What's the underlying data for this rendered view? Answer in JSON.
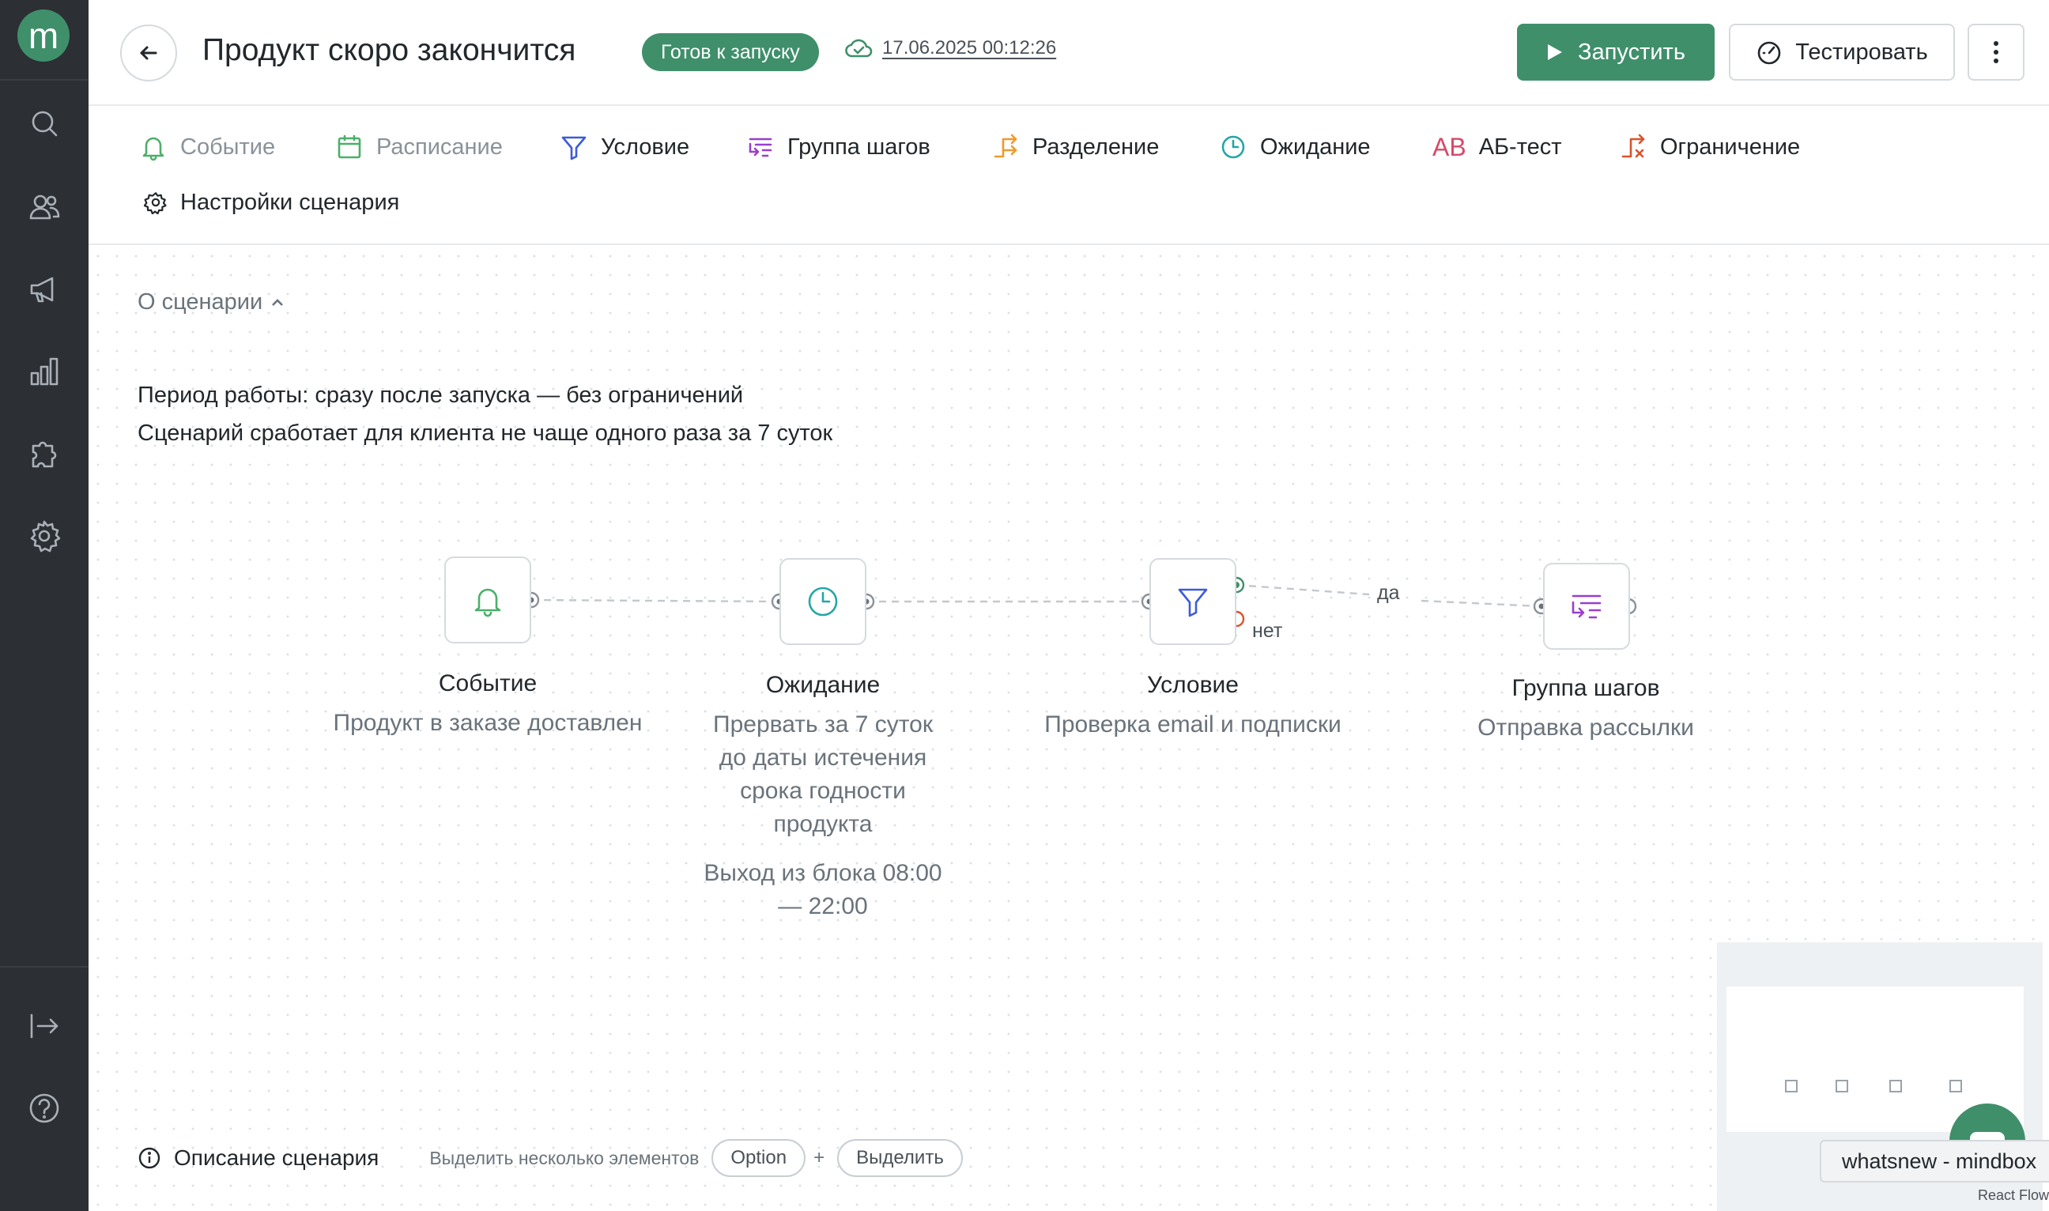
{
  "rail": {
    "logo": "m",
    "items": [
      {
        "icon": "search-icon"
      },
      {
        "icon": "users-icon"
      },
      {
        "icon": "megaphone-icon"
      },
      {
        "icon": "bar-chart-icon"
      },
      {
        "icon": "puzzle-icon"
      },
      {
        "icon": "gear-icon"
      },
      {
        "icon": "logout-icon"
      },
      {
        "icon": "help-icon"
      }
    ]
  },
  "header": {
    "title": "Продукт скоро закончится",
    "status": "Готов к запуску",
    "saved_at": "17.06.2025 00:12:26",
    "run_label": "Запустить",
    "test_label": "Тестировать"
  },
  "toolbar": {
    "items": [
      {
        "label": "Событие",
        "icon": "bell-icon",
        "color": "#4caf6a"
      },
      {
        "label": "Расписание",
        "icon": "calendar-icon",
        "color": "#4caf6a"
      },
      {
        "label": "Условие",
        "icon": "filter-icon",
        "color": "#3d5bd9"
      },
      {
        "label": "Группа шагов",
        "icon": "steps-group-icon",
        "color": "#9b3fc9"
      },
      {
        "label": "Разделение",
        "icon": "split-icon",
        "color": "#f09a2d"
      },
      {
        "label": "Ожидание",
        "icon": "clock-icon",
        "color": "#25a7a7"
      },
      {
        "label": "АБ-тест",
        "icon": "ab-icon",
        "color": "#d64a6a"
      },
      {
        "label": "Ограничение",
        "icon": "limit-icon",
        "color": "#d9532b"
      }
    ],
    "settings_label": "Настройки сценария"
  },
  "about": {
    "toggle_label": "О сценарии",
    "period": "Период работы: сразу после запуска — без ограничений",
    "frequency": "Сценарий сработает для клиента не чаще одного раза за 7 суток"
  },
  "flow": {
    "nodes": [
      {
        "title": "Событие",
        "subtitle": "Продукт в заказе доставлен",
        "icon": "bell-icon"
      },
      {
        "title": "Ожидание",
        "subtitle": "Прервать за 7 суток до даты истечения срока годности продукта",
        "extra": "Выход из блока 08:00 — 22:00",
        "icon": "clock-icon"
      },
      {
        "title": "Условие",
        "subtitle": "Проверка email и подписки",
        "icon": "filter-icon"
      },
      {
        "title": "Группа шагов",
        "subtitle": "Отправка рассылки",
        "icon": "steps-group-icon"
      }
    ],
    "edge_yes": "да",
    "edge_no": "нет"
  },
  "bottom": {
    "description_label": "Описание сценария",
    "multi_select_hint": "Выделить несколько элементов",
    "key_option": "Option",
    "plus": "+",
    "key_select": "Выделить"
  },
  "tooltip": "whatsnew - mindbox",
  "attribution": "React Flow"
}
